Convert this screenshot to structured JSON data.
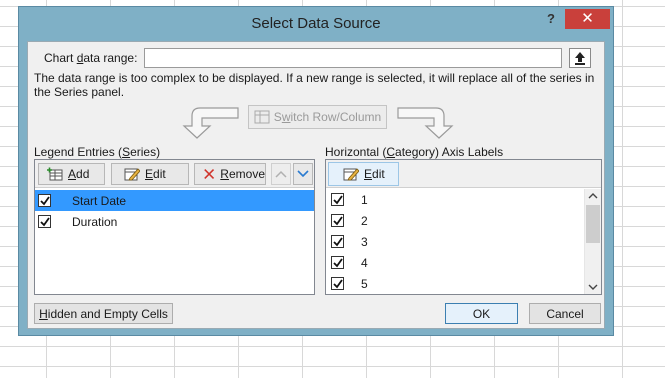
{
  "dialog": {
    "title": "Select Data Source",
    "help_label": "?",
    "close_label": "✕"
  },
  "range": {
    "label_pre": "Chart ",
    "label_ul": "d",
    "label_post": "ata range:",
    "value": ""
  },
  "message": "The data range is too complex to be displayed. If a new range is selected, it will replace all of the series in the Series panel.",
  "switch_button": {
    "pre": "S",
    "ul": "w",
    "post": "itch Row/Column"
  },
  "legend": {
    "title_pre": "Legend Entries (",
    "title_ul": "S",
    "title_post": "eries)",
    "add_ul": "A",
    "add_post": "dd",
    "edit_ul": "E",
    "edit_post": "dit",
    "remove_ul": "R",
    "remove_post": "emove",
    "items": [
      {
        "label": "Start Date",
        "checked": true,
        "selected": true
      },
      {
        "label": "Duration",
        "checked": true,
        "selected": false
      }
    ]
  },
  "axis": {
    "title_pre": "Horizontal (",
    "title_ul": "C",
    "title_post": "ategory) Axis Labels",
    "edit_ul": "E",
    "edit_post": "dit",
    "items": [
      "1",
      "2",
      "3",
      "4",
      "5"
    ]
  },
  "footer": {
    "hidden_ul": "H",
    "hidden_post": "idden and Empty Cells",
    "ok": "OK",
    "cancel": "Cancel"
  },
  "colors": {
    "titlebar": "#7fb0c6",
    "close": "#c9403b",
    "selection": "#3399ff"
  }
}
